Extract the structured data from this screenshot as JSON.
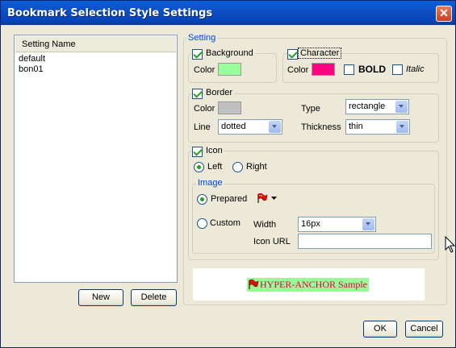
{
  "window": {
    "title": "Bookmark Selection Style Settings",
    "close_glyph": "✕"
  },
  "list": {
    "header": "Setting Name",
    "items": [
      "default",
      "bon01"
    ],
    "new_label": "New",
    "delete_label": "Delete"
  },
  "setting": {
    "group_label": "Setting",
    "background": {
      "label": "Background",
      "checked": true,
      "color_label": "Color",
      "color": "#99ff99"
    },
    "character": {
      "label": "Character",
      "checked": true,
      "color_label": "Color",
      "color": "#ff0080",
      "bold_label": "BOLD",
      "bold_checked": false,
      "italic_label": "Italic",
      "italic_checked": false
    },
    "border": {
      "label": "Border",
      "checked": true,
      "color_label": "Color",
      "color": "#c0c0c0",
      "type_label": "Type",
      "type_value": "rectangle",
      "line_label": "Line",
      "line_value": "dotted",
      "thickness_label": "Thickness",
      "thickness_value": "thin"
    },
    "icon": {
      "label": "Icon",
      "checked": true,
      "left_label": "Left",
      "right_label": "Right",
      "position": "Left",
      "image_group_label": "Image",
      "prepared_label": "Prepared",
      "custom_label": "Custom",
      "source": "Prepared",
      "width_label": "Width",
      "width_value": "16px",
      "url_label": "Icon URL",
      "url_value": "",
      "prepared_icon": "red-flag-icon"
    }
  },
  "sample": {
    "text": "HYPER-ANCHOR Sample",
    "bg": "#98fb98",
    "color": "#e0004d"
  },
  "footer": {
    "ok_label": "OK",
    "cancel_label": "Cancel"
  }
}
